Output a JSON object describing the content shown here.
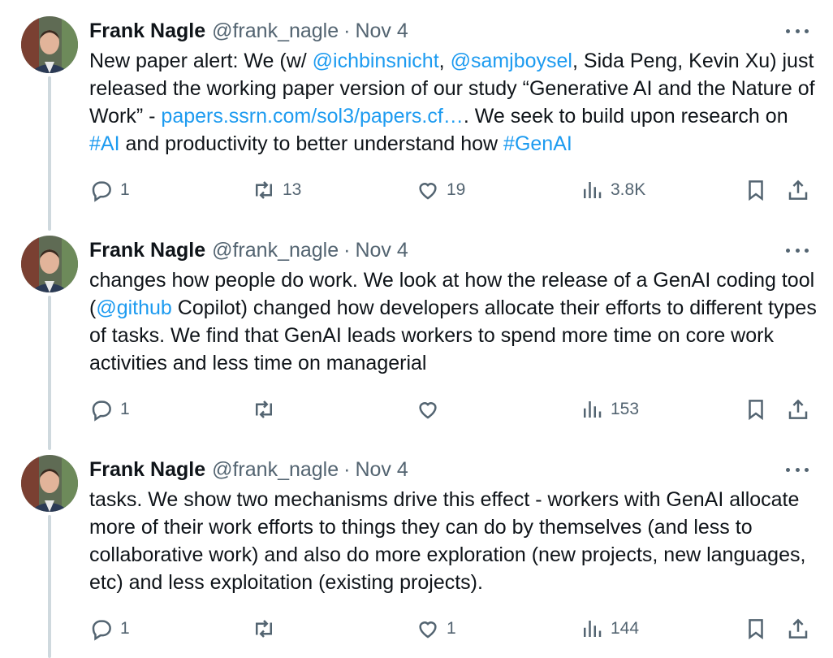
{
  "tweets": [
    {
      "author": "Frank Nagle",
      "handle": "@frank_nagle",
      "sep": "·",
      "date": "Nov 4",
      "segments": [
        {
          "t": "New paper alert: We (w/ "
        },
        {
          "t": "@ichbinsnicht",
          "link": true
        },
        {
          "t": ", "
        },
        {
          "t": "@samjboysel",
          "link": true
        },
        {
          "t": ", Sida Peng, Kevin Xu) just released the working paper version of our study “Generative AI and the Nature of Work” - "
        },
        {
          "t": "papers.ssrn.com/sol3/papers.cf…",
          "link": true
        },
        {
          "t": ". We seek to build upon research on "
        },
        {
          "t": "#AI",
          "link": true
        },
        {
          "t": " and productivity to better understand how "
        },
        {
          "t": "#GenAI",
          "link": true
        }
      ],
      "stats": {
        "replies": "1",
        "reposts": "13",
        "likes": "19",
        "views": "3.8K"
      }
    },
    {
      "author": "Frank Nagle",
      "handle": "@frank_nagle",
      "sep": "·",
      "date": "Nov 4",
      "segments": [
        {
          "t": "changes how people do work. We look at how the release of a GenAI coding tool ("
        },
        {
          "t": "@github",
          "link": true
        },
        {
          "t": " Copilot)  changed how developers allocate their efforts to different types of  tasks. We find that GenAI leads workers to spend more time on core work activities and less time on managerial"
        }
      ],
      "stats": {
        "replies": "1",
        "reposts": "",
        "likes": "",
        "views": "153"
      }
    },
    {
      "author": "Frank Nagle",
      "handle": "@frank_nagle",
      "sep": "·",
      "date": "Nov 4",
      "segments": [
        {
          "t": "tasks. We show two mechanisms drive this effect - workers with GenAI allocate more of their work efforts to things they can do by themselves (and less to collaborative work) and also do more exploration (new projects, new languages, etc) and less exploitation (existing projects)."
        }
      ],
      "stats": {
        "replies": "1",
        "reposts": "",
        "likes": "1",
        "views": "144"
      }
    }
  ],
  "colors": {
    "link": "#1d9bf0",
    "muted": "#536471",
    "text": "#0f1419",
    "thread_line": "#cfd9de"
  },
  "icons": [
    "avatar-photo",
    "more-icon",
    "reply-icon",
    "repost-icon",
    "like-icon",
    "views-icon",
    "bookmark-icon",
    "share-icon"
  ]
}
